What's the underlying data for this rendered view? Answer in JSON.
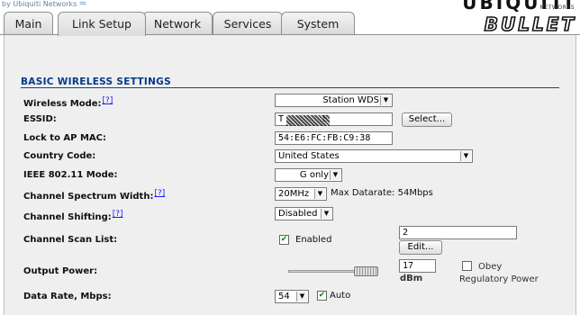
{
  "header": {
    "brand_left": "by Ubiquiti Networks",
    "brand_right": "UBIQUITI",
    "brand_networks": "NETWORKS",
    "product_logo": "BULLET"
  },
  "tabs": [
    {
      "label": "Main"
    },
    {
      "label": "Link Setup",
      "active": true
    },
    {
      "label": "Network"
    },
    {
      "label": "Services"
    },
    {
      "label": "System"
    }
  ],
  "section": {
    "title": "BASIC WIRELESS SETTINGS"
  },
  "help_link": "[?]",
  "form": {
    "wireless_mode": {
      "label": "Wireless Mode:",
      "value": "Station WDS"
    },
    "essid": {
      "label": "ESSID:",
      "value": "T",
      "value_tail": "E",
      "button": "Select..."
    },
    "lock_ap_mac": {
      "label": "Lock to AP MAC:",
      "value": "54:E6:FC:FB:C9:38"
    },
    "country_code": {
      "label": "Country Code:",
      "value": "United States"
    },
    "ieee_mode": {
      "label": "IEEE 802.11 Mode:",
      "value": "G only"
    },
    "channel_width": {
      "label": "Channel Spectrum Width:",
      "value": "20MHz",
      "note": "Max Datarate: 54Mbps"
    },
    "channel_shifting": {
      "label": "Channel Shifting:",
      "value": "Disabled"
    },
    "channel_scan_list": {
      "label": "Channel Scan List:",
      "enabled_label": "Enabled",
      "enabled": true,
      "value": "2",
      "button": "Edit..."
    },
    "output_power": {
      "label": "Output Power:",
      "value": "17",
      "unit": "dBm",
      "obey_label": "Obey",
      "regulatory_label": "Regulatory Power",
      "obey": false
    },
    "data_rate": {
      "label": "Data Rate, Mbps:",
      "value": "54",
      "auto_label": "Auto",
      "auto": true
    }
  },
  "colors": {
    "section_title": "#003a8c",
    "panel_bg": "#efefef",
    "link": "#1a1aff"
  }
}
